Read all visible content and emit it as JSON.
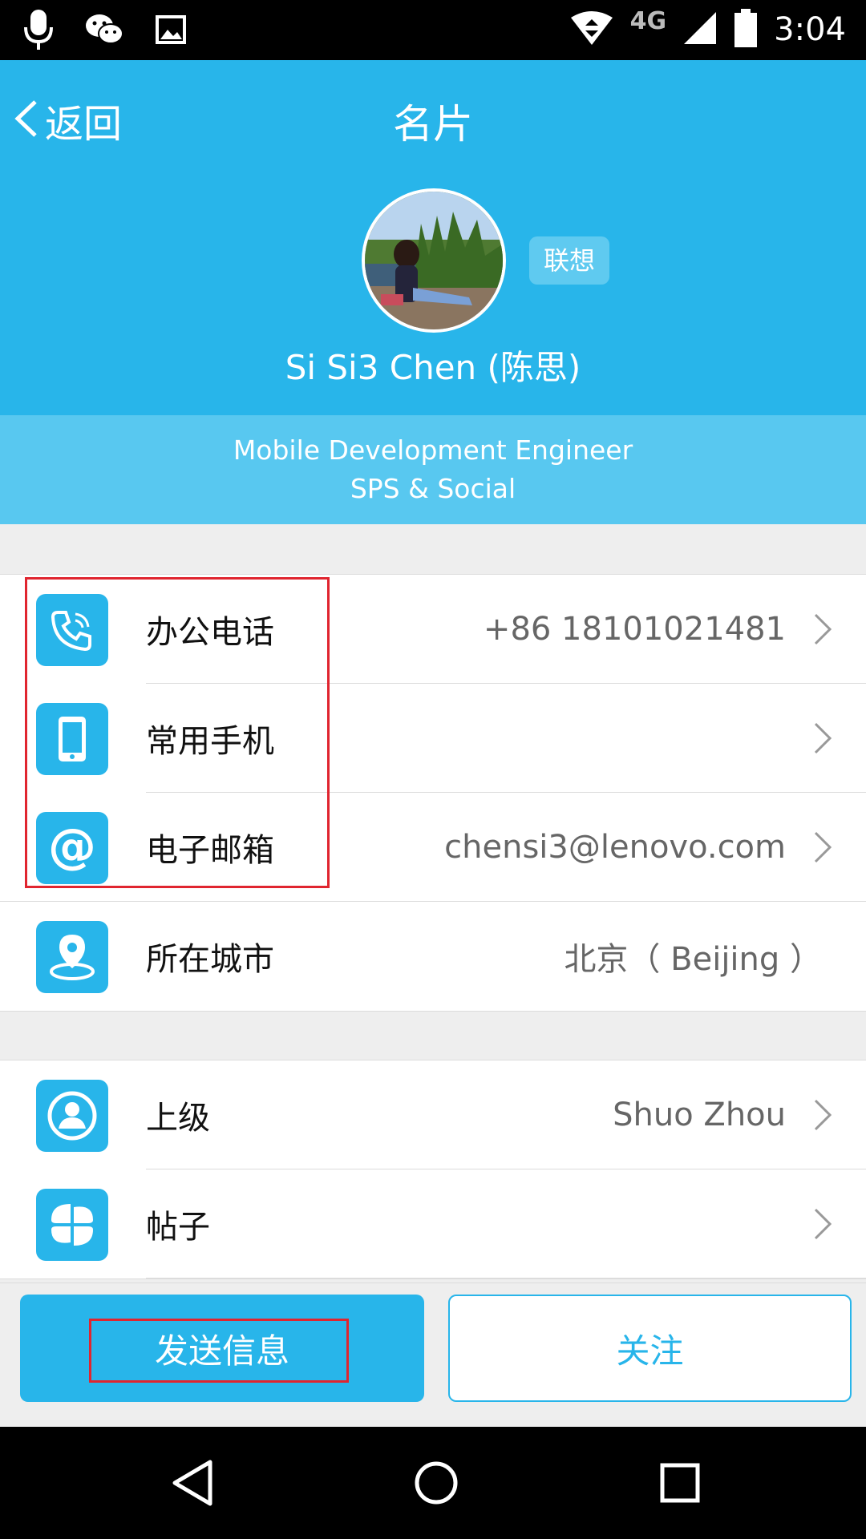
{
  "status_bar": {
    "time": "3:04",
    "network": "4G",
    "icons": [
      "microphone-icon",
      "wechat-icon",
      "image-icon",
      "wifi-icon",
      "signal-icon",
      "battery-icon"
    ]
  },
  "header": {
    "back_label": "返回",
    "title": "名片",
    "company_tag": "联想",
    "user_name": "Si Si3 Chen (陈思)"
  },
  "profile": {
    "job_title": "Mobile Development Engineer",
    "department": "SPS & Social"
  },
  "contact_rows": [
    {
      "label": "办公电话",
      "value": "+86  18101021481",
      "icon": "phone-icon"
    },
    {
      "label": "常用手机",
      "value": "",
      "icon": "mobile-icon"
    },
    {
      "label": "电子邮箱",
      "value": "chensi3@lenovo.com",
      "icon": "email-at-icon"
    },
    {
      "label": "所在城市",
      "value": "北京（ Beijing ）",
      "icon": "location-icon"
    }
  ],
  "relation_rows": [
    {
      "label": "上级",
      "value": "Shuo Zhou",
      "icon": "person-icon"
    },
    {
      "label": "帖子",
      "value": "",
      "icon": "posts-icon"
    }
  ],
  "actions": {
    "send_message": "发送信息",
    "follow": "关注"
  },
  "colors": {
    "accent": "#28b5ea",
    "banner": "#58c8f0",
    "highlight": "#e0252f"
  }
}
